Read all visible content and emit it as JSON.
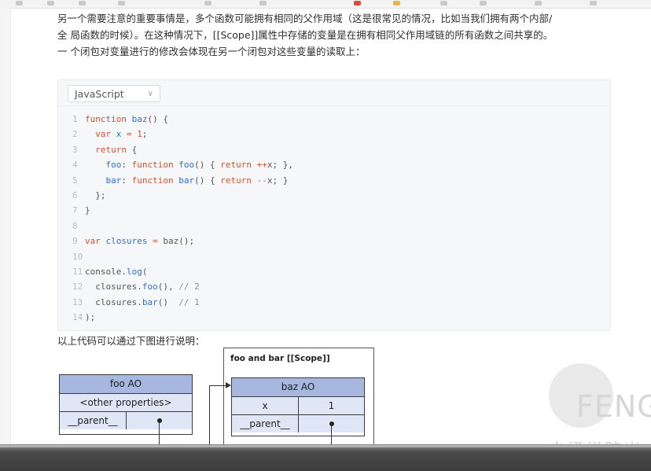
{
  "paragraph": {
    "line1": "另一个需要注意的重要事情是，多个函数可能拥有相同的父作用域（这是很常见的情况，比如当我们拥有两个内部/",
    "line2": "全 局函数的时候）。在这种情况下，[[Scope]]属性中存储的变量是在拥有相同父作用域链的所有函数之间共享的。",
    "line3": "一 个闭包对变量进行的修改会体现在另一个闭包对这些变量的读取上："
  },
  "code_block": {
    "language": "JavaScript",
    "language_icon": "chevron-down-icon"
  },
  "caption": "以上代码可以通过下图进行说明：",
  "diagram": {
    "scope_title": "foo and bar [[Scope]]",
    "foo_ao": {
      "title": "foo AO",
      "row1": "<other properties>",
      "row2_key": "__parent__"
    },
    "baz_ao": {
      "title": "baz AO",
      "row1_key": "x",
      "row1_val": "1",
      "row2_key": "__parent__"
    }
  },
  "watermark": {
    "brand": "FENG",
    "cn": "丰橙学院出"
  },
  "colors": {
    "ao_header": "#a7b7df",
    "ao_row": "#dfe6f5",
    "keyword": "#d0502f",
    "function_name": "#2f6fd1"
  }
}
